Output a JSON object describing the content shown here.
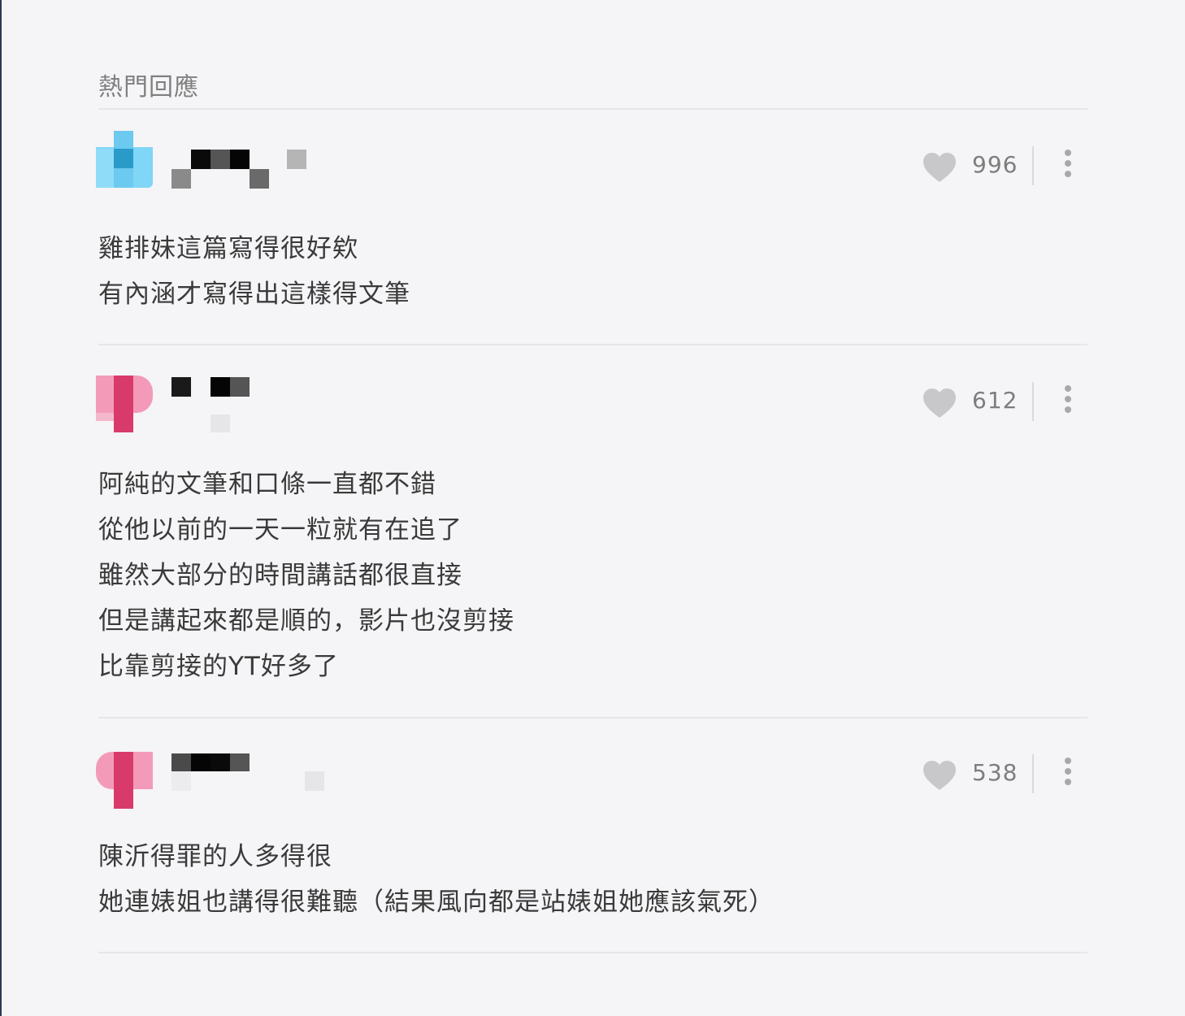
{
  "section_title": "熱門回應",
  "colors": {
    "background": "#f5f4f6",
    "heart": "#c8c7ca",
    "text": "#3a3a3a",
    "avatar_blue": "#6fd2f5",
    "avatar_pink": "#ef7fa8"
  },
  "comments": [
    {
      "likes": "996",
      "lines": [
        "雞排妹這篇寫得很好欸",
        "有內涵才寫得出這樣得文筆"
      ]
    },
    {
      "likes": "612",
      "lines": [
        "阿純的文筆和口條一直都不錯",
        "從他以前的一天一粒就有在追了",
        "雖然大部分的時間講話都很直接",
        "但是講起來都是順的，影片也沒剪接",
        "比靠剪接的YT好多了"
      ]
    },
    {
      "likes": "538",
      "lines": [
        "陳沂得罪的人多得很",
        "她連婊姐也講得很難聽（結果風向都是站婊姐她應該氣死）"
      ]
    }
  ],
  "icons": {
    "like": "heart-icon",
    "more": "more-vertical-icon"
  }
}
